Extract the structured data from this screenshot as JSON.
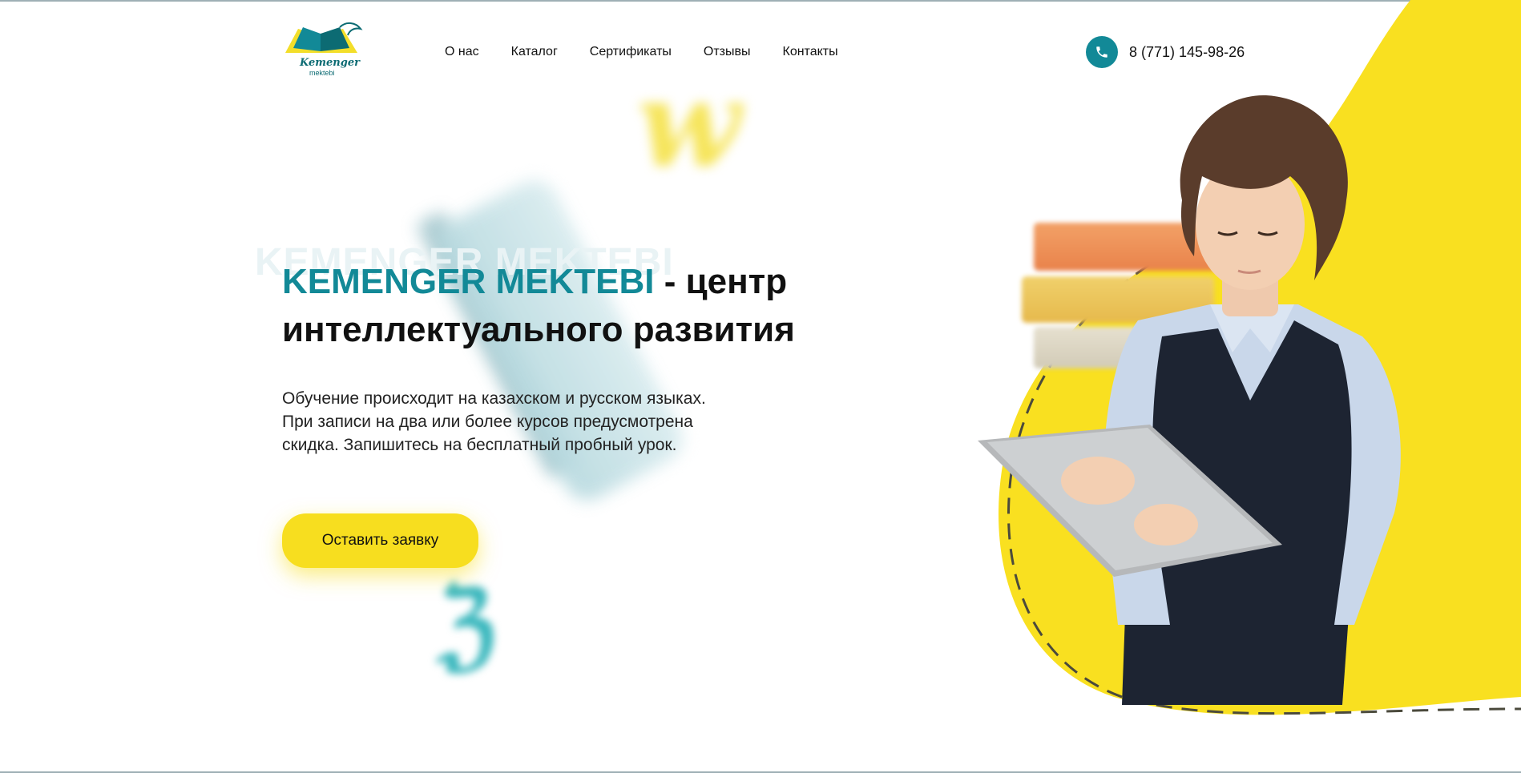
{
  "brand": {
    "logo_name": "Kemenger",
    "logo_sub": "mektebi"
  },
  "nav": {
    "items": [
      "О нас",
      "Каталог",
      "Сертификаты",
      "Отзывы",
      "Контакты"
    ]
  },
  "contact": {
    "phone": "8 (771) 145-98-26"
  },
  "hero": {
    "ghost": "KEMENGER MEKTEBI",
    "title_brand": "KEMENGER MEKTEBI",
    "title_rest": " - центр интеллектуального развития",
    "description": "Обучение происходит на казахском и русском языках. При записи на два или более курсов предусмотрена скидка. Запишитесь на бесплатный пробный урок.",
    "cta": "Оставить заявку"
  },
  "colors": {
    "accent": "#128997",
    "yellow": "#f7de1f",
    "blob": "#f9e020"
  },
  "icons": {
    "phone": "phone-icon"
  }
}
